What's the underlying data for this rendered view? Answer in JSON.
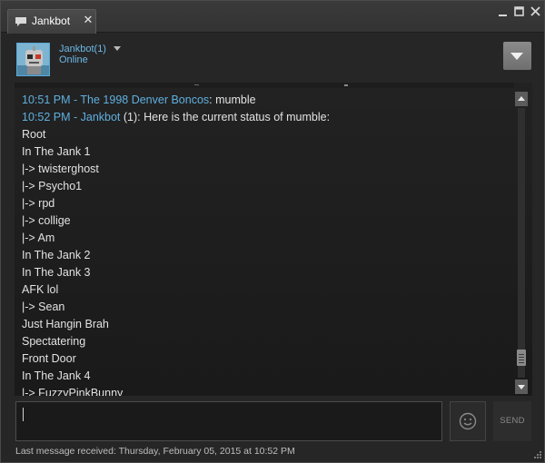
{
  "window": {
    "tab_label": "Jankbot",
    "tab_close": "✕"
  },
  "icons": {
    "tab_icon": "chat-bubble-icon",
    "minimize": "minimize-icon",
    "maximize": "maximize-icon",
    "close": "close-icon",
    "menu": "chevron-down-icon",
    "emoji": "smiley-icon",
    "resize": "resize-grip-icon"
  },
  "friend": {
    "name": "Jankbot",
    "count": "(1)",
    "status": "Online"
  },
  "chat": {
    "messages": [
      {
        "time": "10:51 PM",
        "sender": "The 1998 Denver Boncos",
        "suffix": "",
        "text": ": mumble"
      },
      {
        "time": "10:52 PM",
        "sender": "Jankbot",
        "suffix": " (1)",
        "text": ": Here is the current status of mumble:"
      }
    ],
    "dash": " - ",
    "body_lines": [
      "Root",
      "In The Jank 1",
      "|-> twisterghost",
      "|-> Psycho1",
      "|-> rpd",
      "|-> collige",
      "|-> Am",
      "In The Jank 2",
      "In The Jank 3",
      "AFK lol",
      "|-> Sean",
      "Just Hangin Brah",
      "Spectatering",
      "Front Door",
      "In The Jank 4",
      "|-> FuzzyPinkBunny"
    ]
  },
  "input": {
    "value": ""
  },
  "send_label": "SEND",
  "footer": {
    "last_message": "Last message received: Thursday, February 05, 2015 at 10:52 PM"
  },
  "colors": {
    "accent_link": "#5fb0e0",
    "background": "#262626",
    "log_background": "#1d1d1d"
  }
}
